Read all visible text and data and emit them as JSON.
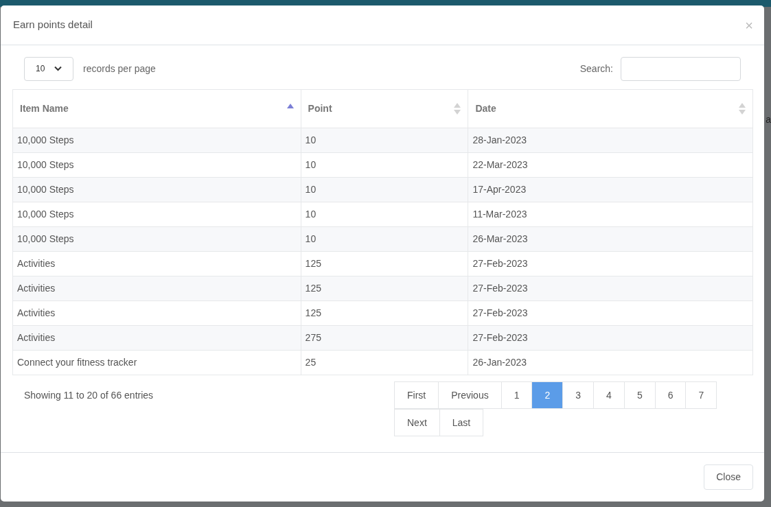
{
  "backdrop": {
    "fragment": "a"
  },
  "dialog": {
    "title": "Earn points detail",
    "close_symbol": "×"
  },
  "length": {
    "value": "10",
    "label": "records per page"
  },
  "search": {
    "label": "Search:"
  },
  "table": {
    "columns": [
      {
        "label": "Item Name",
        "sorted": true
      },
      {
        "label": "Point",
        "sorted": false
      },
      {
        "label": "Date",
        "sorted": false
      }
    ],
    "rows": [
      [
        "10,000 Steps",
        "10",
        "28-Jan-2023"
      ],
      [
        "10,000 Steps",
        "10",
        "22-Mar-2023"
      ],
      [
        "10,000 Steps",
        "10",
        "17-Apr-2023"
      ],
      [
        "10,000 Steps",
        "10",
        "11-Mar-2023"
      ],
      [
        "10,000 Steps",
        "10",
        "26-Mar-2023"
      ],
      [
        "Activities",
        "125",
        "27-Feb-2023"
      ],
      [
        "Activities",
        "125",
        "27-Feb-2023"
      ],
      [
        "Activities",
        "125",
        "27-Feb-2023"
      ],
      [
        "Activities",
        "275",
        "27-Feb-2023"
      ],
      [
        "Connect your fitness tracker",
        "25",
        "26-Jan-2023"
      ]
    ]
  },
  "info": "Showing 11 to 20 of 66 entries",
  "pagination": [
    {
      "label": "First",
      "selected": false
    },
    {
      "label": "Previous",
      "selected": false
    },
    {
      "label": "1",
      "selected": false
    },
    {
      "label": "2",
      "selected": true
    },
    {
      "label": "3",
      "selected": false
    },
    {
      "label": "4",
      "selected": false
    },
    {
      "label": "5",
      "selected": false
    },
    {
      "label": "6",
      "selected": false
    },
    {
      "label": "7",
      "selected": false
    },
    {
      "label": "Next",
      "selected": false
    },
    {
      "label": "Last",
      "selected": false
    }
  ],
  "footer": {
    "close_button": "Close"
  }
}
